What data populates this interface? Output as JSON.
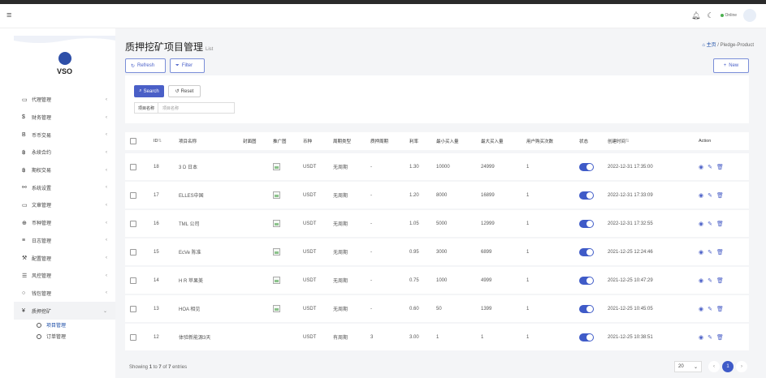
{
  "topbar": {
    "online_label": "Online",
    "menu_icon": "hamburger-icon"
  },
  "sidebar": {
    "logo_text": "VSO",
    "items": [
      {
        "label": "代理管理",
        "icon": "▭"
      },
      {
        "label": "财务管理",
        "icon": "$"
      },
      {
        "label": "币币交易",
        "icon": "B"
      },
      {
        "label": "永续合约",
        "icon": "฿"
      },
      {
        "label": "期权交易",
        "icon": "฿"
      },
      {
        "label": "系统设置",
        "icon": "⚯"
      },
      {
        "label": "文章管理",
        "icon": "▭"
      },
      {
        "label": "币种管理",
        "icon": "⊕"
      },
      {
        "label": "日志管理",
        "icon": "≡"
      },
      {
        "label": "配置管理",
        "icon": "⚒"
      },
      {
        "label": "风控管理",
        "icon": "☰"
      },
      {
        "label": "钱包管理",
        "icon": "○"
      },
      {
        "label": "质押挖矿",
        "icon": "¥"
      }
    ],
    "sub_items": [
      {
        "label": "项目管理"
      },
      {
        "label": "订单管理"
      }
    ]
  },
  "header": {
    "title": "质押挖矿项目管理",
    "subtitle": "List",
    "breadcrumb_home": "主页",
    "breadcrumb_current": "Pledge-Product"
  },
  "toolbar": {
    "refresh_label": "Refresh",
    "filter_label": "Filter",
    "new_label": "New"
  },
  "search": {
    "search_label": "Search",
    "reset_label": "Reset",
    "field_label": "项目名称",
    "placeholder": "项目名称"
  },
  "table": {
    "columns": [
      "ID",
      "项目名称",
      "封面图",
      "推广图",
      "币种",
      "周期类型",
      "质押周期",
      "利率",
      "最小买入量",
      "最大买入量",
      "用户购买次数",
      "状态",
      "创建时间",
      "Action"
    ],
    "rows": [
      {
        "id": "18",
        "name": "3 D 日本",
        "coin": "USDT",
        "cycle_type": "无周期",
        "cycle": "-",
        "rate": "1.30",
        "min": "10000",
        "max": "24999",
        "times": "1",
        "status": true,
        "created": "2022-12-31 17:35:00"
      },
      {
        "id": "17",
        "name": "ELLES中国",
        "coin": "USDT",
        "cycle_type": "无周期",
        "cycle": "-",
        "rate": "1.20",
        "min": "8000",
        "max": "16899",
        "times": "1",
        "status": true,
        "created": "2022-12-31 17:33:09"
      },
      {
        "id": "16",
        "name": "TML 公司",
        "coin": "USDT",
        "cycle_type": "无周期",
        "cycle": "-",
        "rate": "1.05",
        "min": "5000",
        "max": "12999",
        "times": "1",
        "status": true,
        "created": "2022-12-31 17:32:55"
      },
      {
        "id": "15",
        "name": "EcVe 陈准",
        "coin": "USDT",
        "cycle_type": "无周期",
        "cycle": "-",
        "rate": "0.95",
        "min": "3000",
        "max": "6899",
        "times": "1",
        "status": true,
        "created": "2021-12-25 12:24:46"
      },
      {
        "id": "14",
        "name": "H R 苹果美",
        "coin": "USDT",
        "cycle_type": "无周期",
        "cycle": "-",
        "rate": "0.75",
        "min": "1000",
        "max": "4999",
        "times": "1",
        "status": true,
        "created": "2021-12-25 10:47:29"
      },
      {
        "id": "13",
        "name": "HOA 相见",
        "coin": "USDT",
        "cycle_type": "无周期",
        "cycle": "-",
        "rate": "0.60",
        "min": "50",
        "max": "1399",
        "times": "1",
        "status": true,
        "created": "2021-12-25 10:45:05"
      },
      {
        "id": "12",
        "name": "体验新能源3天",
        "coin": "USDT",
        "cycle_type": "有周期",
        "cycle": "3",
        "rate": "3.00",
        "min": "1",
        "max": "1",
        "times": "1",
        "status": true,
        "created": "2021-12-25 10:38:51"
      }
    ]
  },
  "footer": {
    "info_prefix": "Showing ",
    "info_from": "1",
    "info_to_word": " to ",
    "info_to": "7",
    "info_of_word": " of ",
    "info_total": "7",
    "info_suffix": " entries",
    "page_size": "20",
    "current_page": "1"
  },
  "colors": {
    "accent": "#3f5bc8",
    "content_bg": "#f4f5f7"
  }
}
